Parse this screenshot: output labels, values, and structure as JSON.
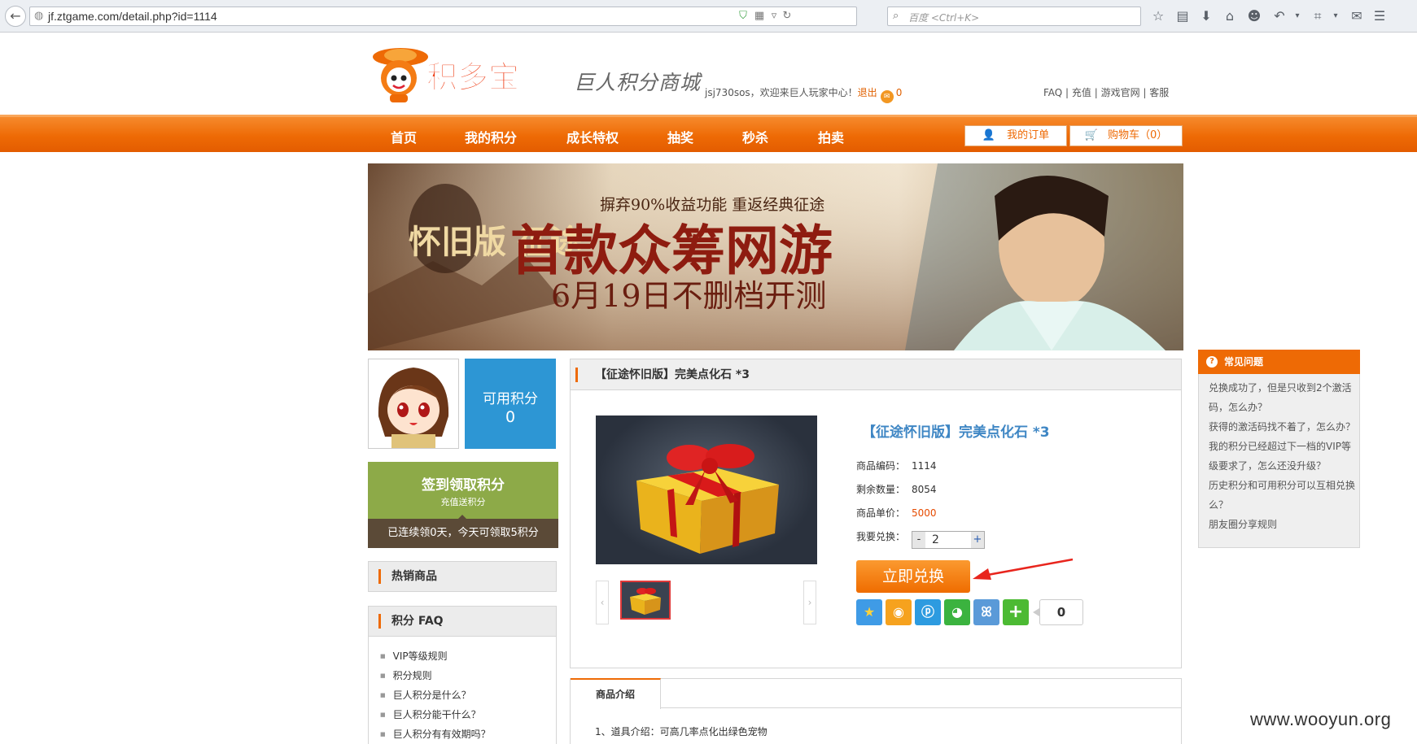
{
  "browser": {
    "url": "jf.ztgame.com/detail.php?id=1114",
    "search_placeholder": "百度 <Ctrl+K>"
  },
  "header": {
    "logo_text": "积多宝",
    "slogan": "巨人积分商城",
    "welcome": "jsj730sos，欢迎来巨人玩家中心！",
    "logout": "退出",
    "mail_count": "0",
    "top_links": "FAQ | 充值 | 游戏官网 | 客服"
  },
  "nav": {
    "items": [
      "首页",
      "我的积分",
      "成长特权",
      "抽奖",
      "秒杀",
      "拍卖"
    ],
    "my_orders": "我的订单",
    "cart": "购物车（0）"
  },
  "banner": {
    "subtitle": "摒弃90%收益功能 重返经典征途",
    "headline": "首款众筹网游",
    "date_line": "6月19日不删档开测",
    "game_logo": "怀旧版 征途"
  },
  "user": {
    "points_label": "可用积分",
    "points_value": "0",
    "signin_title": "签到领取积分",
    "signin_sub": "充值送积分",
    "signin_status": "已连续领0天，今天可领取5积分"
  },
  "sidebar": {
    "hot_title": "热销商品",
    "faq_title": "积分 FAQ",
    "faq_items": [
      "VIP等级规则",
      "积分规则",
      "巨人积分是什么？",
      "巨人积分能干什么？",
      "巨人积分有有效期吗？"
    ]
  },
  "product": {
    "breadcrumb_title": "【征途怀旧版】完美点化石 *3",
    "title": "【征途怀旧版】完美点化石 *3",
    "code_label": "商品编码：",
    "code": "1114",
    "stock_label": "剩余数量：",
    "stock": "8054",
    "price_label": "商品单价：",
    "price": "5000",
    "qty_label": "我要兑换：",
    "qty": "2",
    "qty_minus": "-",
    "qty_plus": "+",
    "exchange_button": "立即兑换",
    "share_count": "0",
    "prev": "‹",
    "next": "›"
  },
  "description": {
    "tab": "商品介绍",
    "line1": "1、道具介绍：可高几率点化出绿色宠物"
  },
  "right_faq": {
    "title": "常见问题",
    "items": [
      "兑换成功了，但是只收到2个激活码，怎么办？",
      "获得的激活码找不着了，怎么办？",
      "我的积分已经超过下一档的VIP等级要求了，怎么还没升级？",
      "历史积分和可用积分可以互相兑换么？",
      "朋友圈分享规则"
    ]
  },
  "watermark": "www.wooyun.org",
  "colors": {
    "accent": "#ee6a05",
    "blue": "#2d96d4",
    "green": "#8daa48",
    "link": "#3e86c4"
  }
}
